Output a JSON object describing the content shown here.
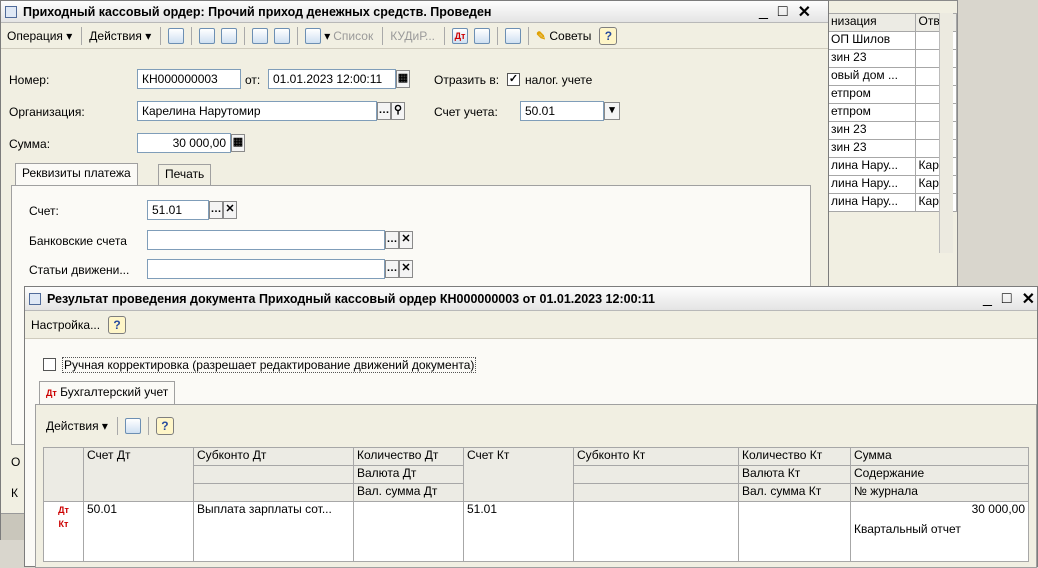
{
  "bg_list": {
    "headers": [
      "низация",
      "Отве"
    ],
    "rows": [
      [
        "ОП  Шилов",
        ""
      ],
      [
        "зин 23",
        ""
      ],
      [
        "овый дом ...",
        ""
      ],
      [
        "етпром",
        ""
      ],
      [
        "етпром",
        ""
      ],
      [
        "зин 23",
        ""
      ],
      [
        "зин 23",
        ""
      ],
      [
        "лина Нару...",
        "Каре"
      ],
      [
        "лина Нару...",
        "Каре"
      ],
      [
        "лина Нару...",
        "Каре"
      ]
    ]
  },
  "order_window": {
    "title": "Приходный кассовый ордер: Прочий приход денежных средств. Проведен",
    "toolbar": {
      "operation": "Операция",
      "actions": "Действия",
      "list": "Список",
      "kudir": "КУДиР...",
      "tips": "Советы"
    },
    "form": {
      "number_label": "Номер:",
      "number_value": "КН000000003",
      "from_label": "от:",
      "date_value": "01.01.2023 12:00:11",
      "reflect_label": "Отразить в:",
      "tax_label": "налог. учете",
      "org_label": "Организация:",
      "org_value": "Карелина Нарутомир",
      "account_label": "Счет учета:",
      "account_value": "50.01",
      "sum_label": "Сумма:",
      "sum_value": "30 000,00"
    },
    "tabs": [
      "Реквизиты платежа",
      "Печать"
    ],
    "payment": {
      "account_label": "Счет:",
      "account_value": "51.01",
      "bank_label": "Банковские счета",
      "move_label": "Статьи движени..."
    },
    "cut_labels": [
      "О",
      "К"
    ]
  },
  "result_window": {
    "title": "Результат проведения документа Приходный кассовый ордер КН000000003 от 01.01.2023 12:00:11",
    "settings_label": "Настройка...",
    "manual_label": "Ручная корректировка (разрешает редактирование движений документа)",
    "tab_label": "Бухгалтерский учет",
    "actions_label": "Действия",
    "headers": {
      "acc_dt": "Счет Дт",
      "sub_dt": "Субконто Дт",
      "qty_dt": "Количество Дт",
      "cur_dt": "Валюта Дт",
      "cursum_dt": "Вал. сумма Дт",
      "acc_kt": "Счет Кт",
      "sub_kt": "Субконто Кт",
      "qty_kt": "Количество Кт",
      "cur_kt": "Валюта Кт",
      "cursum_kt": "Вал. сумма Кт",
      "sum": "Сумма",
      "content": "Содержание",
      "journal": "№ журнала"
    },
    "row": {
      "acc_dt": "50.01",
      "sub_dt": "Выплата зарплаты сот...",
      "acc_kt": "51.01",
      "sum": "30 000,00",
      "content": "Квартальный отчет"
    }
  }
}
